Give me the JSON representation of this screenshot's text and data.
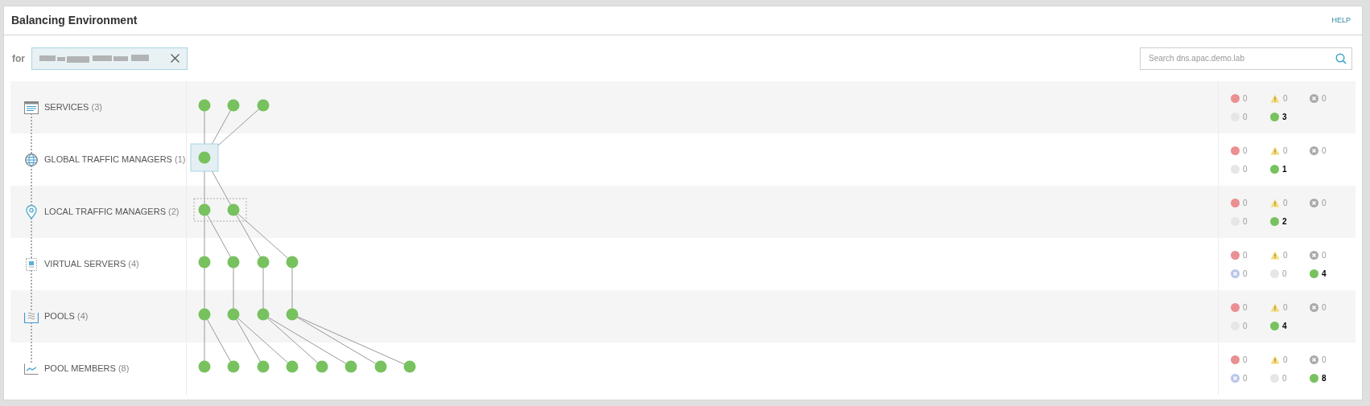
{
  "header": {
    "title": "Balancing Environment",
    "help": "HELP"
  },
  "filter": {
    "label": "for"
  },
  "search": {
    "placeholder": "Search dns.apac.demo.lab"
  },
  "rows": [
    {
      "kind": "services",
      "label": "SERVICES",
      "count": "(3)",
      "status_lines": [
        [
          {
            "kind": "critical",
            "value": "0"
          },
          {
            "kind": "warning",
            "value": "0"
          },
          {
            "kind": "down",
            "value": "0"
          }
        ],
        [
          {
            "kind": "unknown",
            "value": "0"
          },
          {
            "kind": "up",
            "value": "3"
          }
        ]
      ]
    },
    {
      "kind": "globe",
      "label": "GLOBAL TRAFFIC MANAGERS",
      "count": "(1)",
      "status_lines": [
        [
          {
            "kind": "critical",
            "value": "0"
          },
          {
            "kind": "warning",
            "value": "0"
          },
          {
            "kind": "down",
            "value": "0"
          }
        ],
        [
          {
            "kind": "unknown",
            "value": "0"
          },
          {
            "kind": "up",
            "value": "1"
          }
        ]
      ]
    },
    {
      "kind": "pin",
      "label": "LOCAL TRAFFIC MANAGERS",
      "count": "(2)",
      "status_lines": [
        [
          {
            "kind": "critical",
            "value": "0"
          },
          {
            "kind": "warning",
            "value": "0"
          },
          {
            "kind": "down",
            "value": "0"
          }
        ],
        [
          {
            "kind": "unknown",
            "value": "0"
          },
          {
            "kind": "up",
            "value": "2"
          }
        ]
      ]
    },
    {
      "kind": "server",
      "label": "VIRTUAL SERVERS",
      "count": "(4)",
      "status_lines": [
        [
          {
            "kind": "critical",
            "value": "0"
          },
          {
            "kind": "warning",
            "value": "0"
          },
          {
            "kind": "down",
            "value": "0"
          }
        ],
        [
          {
            "kind": "unmanaged",
            "value": "0"
          },
          {
            "kind": "unknown",
            "value": "0"
          },
          {
            "kind": "up",
            "value": "4"
          }
        ]
      ]
    },
    {
      "kind": "pool",
      "label": "POOLS",
      "count": "(4)",
      "status_lines": [
        [
          {
            "kind": "critical",
            "value": "0"
          },
          {
            "kind": "warning",
            "value": "0"
          },
          {
            "kind": "down",
            "value": "0"
          }
        ],
        [
          {
            "kind": "unknown",
            "value": "0"
          },
          {
            "kind": "up",
            "value": "4"
          }
        ]
      ]
    },
    {
      "kind": "member",
      "label": "POOL MEMBERS",
      "count": "(8)",
      "status_lines": [
        [
          {
            "kind": "critical",
            "value": "0"
          },
          {
            "kind": "warning",
            "value": "0"
          },
          {
            "kind": "down",
            "value": "0"
          }
        ],
        [
          {
            "kind": "unmanaged",
            "value": "0"
          },
          {
            "kind": "unknown",
            "value": "0"
          },
          {
            "kind": "up",
            "value": "8"
          }
        ]
      ]
    }
  ]
}
